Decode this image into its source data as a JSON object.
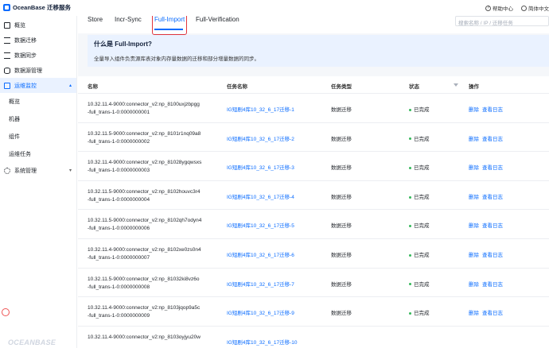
{
  "app": {
    "title": "OceanBase 迁移服务"
  },
  "topbar": {
    "help": "帮助中心",
    "lang": "简体中文"
  },
  "sidebar": {
    "items": [
      {
        "label": "概览",
        "icon": "overview-icon"
      },
      {
        "label": "数据迁移",
        "icon": "migrate-icon"
      },
      {
        "label": "数据同步",
        "icon": "sync-icon"
      },
      {
        "label": "数据源管理",
        "icon": "datasource-icon"
      },
      {
        "label": "运维监控",
        "icon": "monitor-icon"
      }
    ],
    "sub_items": [
      "概览",
      "机器",
      "组件",
      "运维任务"
    ],
    "system": "系统管理",
    "watermark": "OCEANBASE"
  },
  "tabs": [
    "Store",
    "Incr-Sync",
    "Full-Import",
    "Full-Verification"
  ],
  "search": {
    "placeholder": "搜索名称 / IP / 迁移任务"
  },
  "info": {
    "title": "什么是 Full-Import?",
    "desc": "全量导入组件负责源库表对象内存量数据的迁移和部分增量数据的同步。"
  },
  "table": {
    "headers": {
      "name": "名称",
      "task": "任务名称",
      "type": "任务类型",
      "status": "状态",
      "op": "操作"
    },
    "rows": [
      {
        "name1": "10.32.11.4-9000:connector_v2:np_8100uxjzbpgg",
        "name2": "-full_trans-1-0:0000000001",
        "task": "IG短剧4库10_32_6_17迁移-1",
        "type": "数据迁移",
        "status": "已完成",
        "del": "删除",
        "log": "查看日志"
      },
      {
        "name1": "10.32.11.5-9000:connector_v2:np_8101r1nq09a8",
        "name2": "-full_trans-1-0:0000000002",
        "task": "IG短剧4库10_32_6_17迁移-2",
        "type": "数据迁移",
        "status": "已完成",
        "del": "删除",
        "log": "查看日志"
      },
      {
        "name1": "10.32.11.4-9000:connector_v2:np_81028ygqwsxs",
        "name2": "-full_trans-1-0:0000000003",
        "task": "IG短剧4库10_32_6_17迁移-3",
        "type": "数据迁移",
        "status": "已完成",
        "del": "删除",
        "log": "查看日志"
      },
      {
        "name1": "10.32.11.5-9000:connector_v2:np_8102houvc3r4",
        "name2": "-full_trans-1-0:0000000004",
        "task": "IG短剧4库10_32_6_17迁移-4",
        "type": "数据迁移",
        "status": "已完成",
        "del": "删除",
        "log": "查看日志"
      },
      {
        "name1": "10.32.11.5-9000:connector_v2:np_8102qh7odyn4",
        "name2": "-full_trans-1-0:0000000006",
        "task": "IG短剧4库10_32_6_17迁移-5",
        "type": "数据迁移",
        "status": "已完成",
        "del": "删除",
        "log": "查看日志"
      },
      {
        "name1": "10.32.11.4-9000:connector_v2:np_8102xe0zs0n4",
        "name2": "-full_trans-1-0:0000000007",
        "task": "IG短剧4库10_32_6_17迁移-6",
        "type": "数据迁移",
        "status": "已完成",
        "del": "删除",
        "log": "查看日志"
      },
      {
        "name1": "10.32.11.5-9000:connector_v2:np_81032ki8vz6o",
        "name2": "-full_trans-1-0:0000000008",
        "task": "IG短剧4库10_32_6_17迁移-7",
        "type": "数据迁移",
        "status": "已完成",
        "del": "删除",
        "log": "查看日志"
      },
      {
        "name1": "10.32.11.4-9000:connector_v2:np_8103jqop9a5c",
        "name2": "-full_trans-1-0:0000000009",
        "task": "IG短剧4库10_32_6_17迁移-9",
        "type": "数据迁移",
        "status": "已完成",
        "del": "删除",
        "log": "查看日志"
      },
      {
        "name1": "10.32.11.4-9000:connector_v2:np_8103oyjyu20w",
        "name2": "",
        "task": "IG短剧4库10_32_6_17迁移-10",
        "type": "",
        "status": "",
        "del": "",
        "log": ""
      }
    ]
  },
  "colors": {
    "accent": "#0a6cff",
    "success": "#35b85a",
    "highlight": "#e0353d",
    "info_bg": "#eaf2ff"
  }
}
